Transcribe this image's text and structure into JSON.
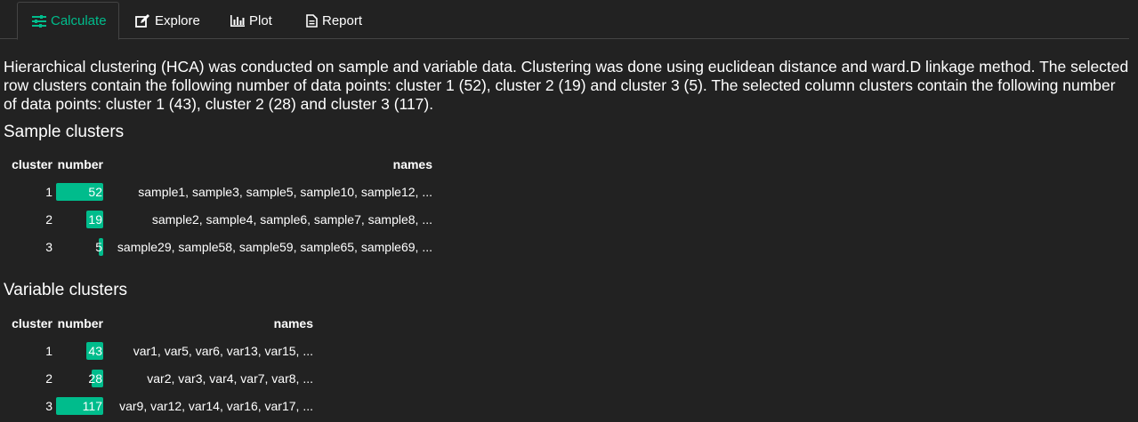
{
  "tabs": [
    {
      "label": "Calculate",
      "icon": "sliders-icon",
      "active": true
    },
    {
      "label": "Explore",
      "icon": "edit-icon",
      "active": false
    },
    {
      "label": "Plot",
      "icon": "bar-chart-icon",
      "active": false
    },
    {
      "label": "Report",
      "icon": "file-icon",
      "active": false
    }
  ],
  "accent_color": "#00bc8c",
  "summary": "Hierarchical clustering (HCA) was conducted on sample and variable data. Clustering was done using euclidean distance and ward.D linkage method. The selected row clusters contain the following number of data points: cluster 1 (52), cluster 2 (19) and cluster 3 (5). The selected column clusters contain the following number of data points: cluster 1 (43), cluster 2 (28) and cluster 3 (117).",
  "sample_clusters": {
    "title": "Sample clusters",
    "headers": {
      "cluster": "cluster",
      "number": "number",
      "names": "names"
    },
    "rows": [
      {
        "cluster": "1",
        "number": "52",
        "fraction": 1.0,
        "names": "sample1, sample3, sample5, sample10, sample12, ..."
      },
      {
        "cluster": "2",
        "number": "19",
        "fraction": 0.365,
        "names": "sample2, sample4, sample6, sample7, sample8, ..."
      },
      {
        "cluster": "3",
        "number": "5",
        "fraction": 0.096,
        "names": "sample29, sample58, sample59, sample65, sample69, ..."
      }
    ]
  },
  "variable_clusters": {
    "title": "Variable clusters",
    "headers": {
      "cluster": "cluster",
      "number": "number",
      "names": "names"
    },
    "rows": [
      {
        "cluster": "1",
        "number": "43",
        "fraction": 0.3675,
        "names": "var1, var5, var6, var13, var15, ..."
      },
      {
        "cluster": "2",
        "number": "28",
        "fraction": 0.239,
        "names": "var2, var3, var4, var7, var8, ..."
      },
      {
        "cluster": "3",
        "number": "117",
        "fraction": 1.0,
        "names": "var9, var12, var14, var16, var17, ..."
      }
    ]
  }
}
